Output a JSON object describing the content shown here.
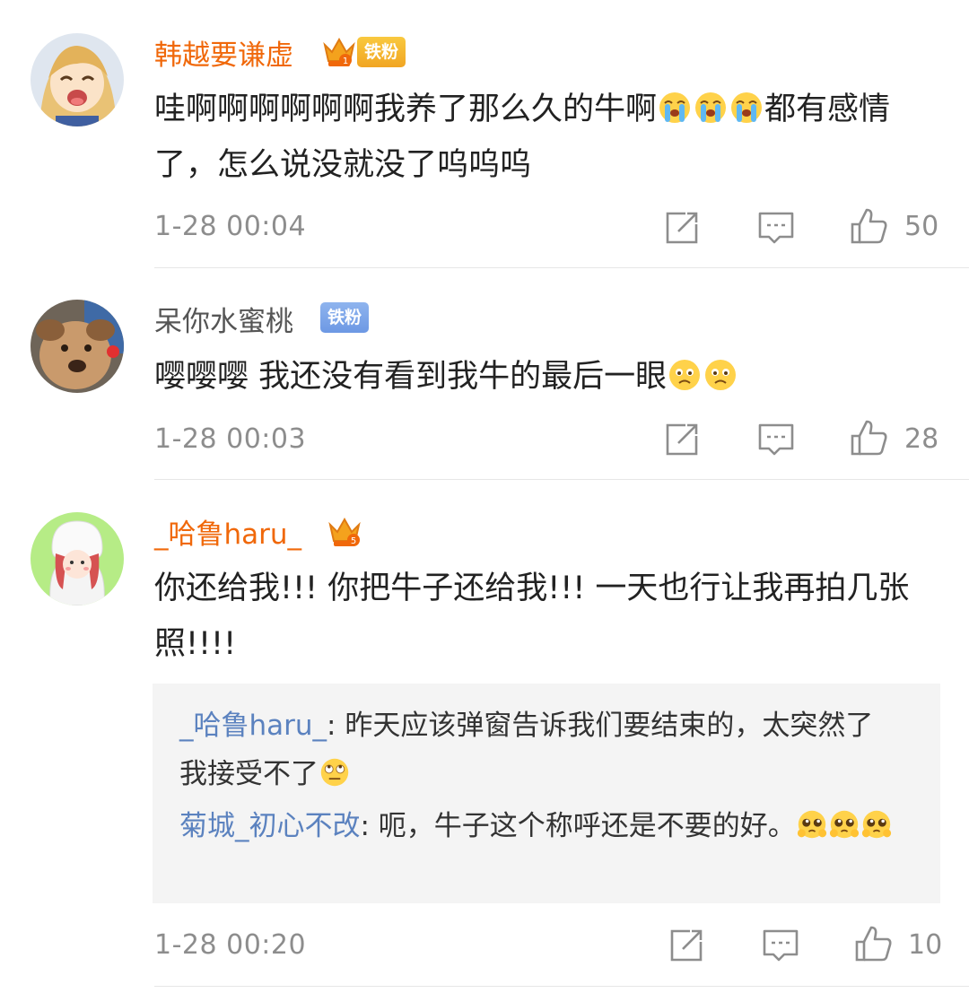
{
  "comments": [
    {
      "username": "韩越要谦虚",
      "crown_level": "1",
      "fan_badge": "铁粉",
      "text_before": "哇啊啊啊啊啊啊我养了那么久的牛啊",
      "emoji_1": "crying-emoji",
      "text_after": "都有感情了，怎么说没就没了呜呜呜",
      "time": "1-28 00:04",
      "likes": "50"
    },
    {
      "username": "呆你水蜜桃",
      "fan_badge": "铁粉",
      "text_before": "嘤嘤嘤 我还没有看到我牛的最后一眼",
      "emoji_1": "sad-emoji",
      "time": "1-28 00:03",
      "likes": "28"
    },
    {
      "username": "_哈鲁haru_",
      "crown_level": "5",
      "text": "你还给我!!! 你把牛子还给我!!! 一天也行让我再拍几张照!!!!",
      "time": "1-28 00:20",
      "likes": "10",
      "replies": [
        {
          "username": "_哈鲁haru_",
          "separator": ":",
          "text": " 昨天应该弹窗告诉我们要结束的，太突然了我接受不了",
          "emoji": "eye-roll-emoji"
        },
        {
          "username": "菊城_初心不改",
          "separator": ":",
          "text": " 呃，牛子这个称呼还是不要的好。",
          "emoji": "pleading-emoji"
        }
      ]
    }
  ],
  "colors": {
    "vip_name": "#f0680a",
    "normal_name": "#555555",
    "reply_name": "#5b82bf",
    "meta_text": "#8d8d8d",
    "reply_bg": "#f4f4f4"
  }
}
